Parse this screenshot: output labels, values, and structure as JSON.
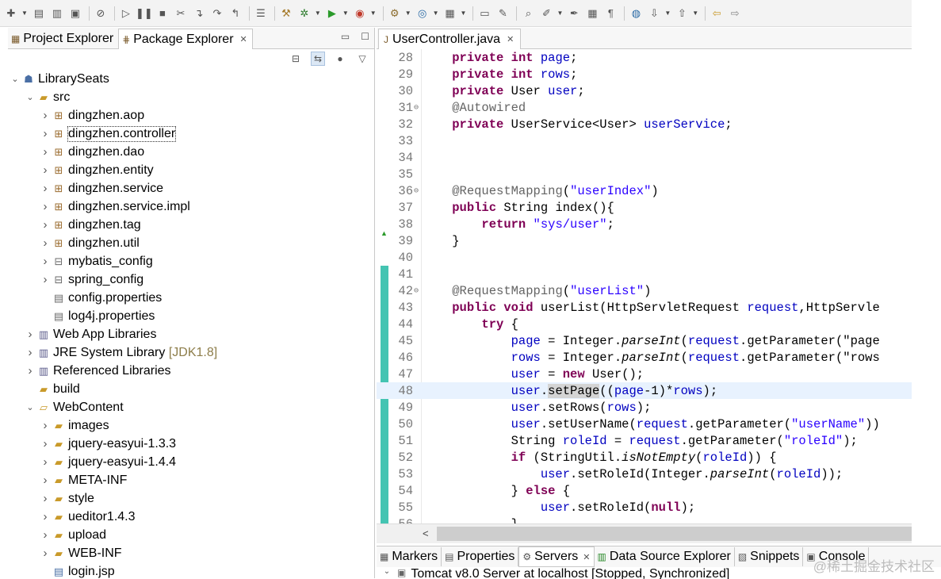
{
  "toolbar": {
    "icons": [
      "new-icon",
      "save-icon",
      "save-all-icon",
      "print-icon",
      "skip-breakpoints-icon",
      "resume-icon",
      "suspend-icon",
      "terminate-icon",
      "disconnect-icon",
      "step-into-icon",
      "step-over-icon",
      "step-return-icon",
      "open-task-icon",
      "build-icon",
      "debug-icon",
      "run-icon",
      "run-external-icon",
      "new-server-icon",
      "new-java-project-icon",
      "open-type-icon",
      "open-folder-icon",
      "open-resource-icon",
      "search-icon",
      "annotation-icon",
      "pen-icon",
      "block-icon",
      "paragraph-icon",
      "globe-icon",
      "next-annotation-icon",
      "previous-annotation-icon",
      "back-icon",
      "forward-icon"
    ]
  },
  "explorer": {
    "tabs": [
      {
        "label": "Project Explorer",
        "active": false
      },
      {
        "label": "Package Explorer",
        "active": true
      }
    ],
    "tree": [
      {
        "label": "LibrarySeats",
        "level": 0,
        "chevron": "open",
        "icon": "project-icon"
      },
      {
        "label": "src",
        "level": 1,
        "chevron": "open",
        "icon": "source-folder-icon"
      },
      {
        "label": "dingzhen.aop",
        "level": 2,
        "chevron": "closed",
        "icon": "package-icon"
      },
      {
        "label": "dingzhen.controller",
        "level": 2,
        "chevron": "closed",
        "icon": "package-icon",
        "selected": true
      },
      {
        "label": "dingzhen.dao",
        "level": 2,
        "chevron": "closed",
        "icon": "package-icon"
      },
      {
        "label": "dingzhen.entity",
        "level": 2,
        "chevron": "closed",
        "icon": "package-icon"
      },
      {
        "label": "dingzhen.service",
        "level": 2,
        "chevron": "closed",
        "icon": "package-icon"
      },
      {
        "label": "dingzhen.service.impl",
        "level": 2,
        "chevron": "closed",
        "icon": "package-icon"
      },
      {
        "label": "dingzhen.tag",
        "level": 2,
        "chevron": "closed",
        "icon": "package-icon"
      },
      {
        "label": "dingzhen.util",
        "level": 2,
        "chevron": "closed",
        "icon": "package-icon"
      },
      {
        "label": "mybatis_config",
        "level": 2,
        "chevron": "closed",
        "icon": "config-package-icon"
      },
      {
        "label": "spring_config",
        "level": 2,
        "chevron": "closed",
        "icon": "config-package-icon"
      },
      {
        "label": "config.properties",
        "level": 2,
        "chevron": "none",
        "icon": "file-icon"
      },
      {
        "label": "log4j.properties",
        "level": 2,
        "chevron": "none",
        "icon": "file-icon"
      },
      {
        "label": "Web App Libraries",
        "level": 1,
        "chevron": "closed",
        "icon": "library-icon"
      },
      {
        "label": "JRE System Library",
        "suffix": "[JDK1.8]",
        "level": 1,
        "chevron": "closed",
        "icon": "library-icon"
      },
      {
        "label": "Referenced Libraries",
        "level": 1,
        "chevron": "closed",
        "icon": "library-icon"
      },
      {
        "label": "build",
        "level": 1,
        "chevron": "none",
        "icon": "folder-icon"
      },
      {
        "label": "WebContent",
        "level": 1,
        "chevron": "open",
        "icon": "folder-open-icon"
      },
      {
        "label": "images",
        "level": 2,
        "chevron": "closed",
        "icon": "folder-icon"
      },
      {
        "label": "jquery-easyui-1.3.3",
        "level": 2,
        "chevron": "closed",
        "icon": "folder-icon"
      },
      {
        "label": "jquery-easyui-1.4.4",
        "level": 2,
        "chevron": "closed",
        "icon": "folder-icon"
      },
      {
        "label": "META-INF",
        "level": 2,
        "chevron": "closed",
        "icon": "folder-icon"
      },
      {
        "label": "style",
        "level": 2,
        "chevron": "closed",
        "icon": "folder-icon"
      },
      {
        "label": "ueditor1.4.3",
        "level": 2,
        "chevron": "closed",
        "icon": "folder-icon"
      },
      {
        "label": "upload",
        "level": 2,
        "chevron": "closed",
        "icon": "folder-icon"
      },
      {
        "label": "WEB-INF",
        "level": 2,
        "chevron": "closed",
        "icon": "folder-icon"
      },
      {
        "label": "login.jsp",
        "level": 2,
        "chevron": "none",
        "icon": "jsp-file-icon"
      }
    ]
  },
  "editor": {
    "tab_label": "UserController.java",
    "current_line": 48,
    "lines": [
      {
        "n": "28",
        "tokens": [
          [
            "    ",
            ""
          ],
          [
            "private",
            "kw"
          ],
          [
            " ",
            ""
          ],
          [
            "int",
            "kw"
          ],
          [
            " ",
            ""
          ],
          [
            "page",
            "fld"
          ],
          [
            ";",
            ""
          ]
        ]
      },
      {
        "n": "29",
        "tokens": [
          [
            "    ",
            ""
          ],
          [
            "private",
            "kw"
          ],
          [
            " ",
            ""
          ],
          [
            "int",
            "kw"
          ],
          [
            " ",
            ""
          ],
          [
            "rows",
            "fld"
          ],
          [
            ";",
            ""
          ]
        ]
      },
      {
        "n": "30",
        "tokens": [
          [
            "    ",
            ""
          ],
          [
            "private",
            "kw"
          ],
          [
            " User ",
            ""
          ],
          [
            "user",
            "fld"
          ],
          [
            ";",
            ""
          ]
        ]
      },
      {
        "n": "31",
        "fold": true,
        "tokens": [
          [
            "    ",
            ""
          ],
          [
            "@Autowired",
            "ann"
          ]
        ]
      },
      {
        "n": "32",
        "tokens": [
          [
            "    ",
            ""
          ],
          [
            "private",
            "kw"
          ],
          [
            " UserService<User> ",
            ""
          ],
          [
            "userService",
            "fld"
          ],
          [
            ";",
            ""
          ]
        ]
      },
      {
        "n": "33",
        "tokens": []
      },
      {
        "n": "34",
        "tokens": []
      },
      {
        "n": "35",
        "tokens": []
      },
      {
        "n": "36",
        "fold": true,
        "tokens": [
          [
            "    ",
            ""
          ],
          [
            "@RequestMapping",
            "ann"
          ],
          [
            "(",
            ""
          ],
          [
            "\"userIndex\"",
            "str"
          ],
          [
            ")",
            ""
          ]
        ]
      },
      {
        "n": "37",
        "tokens": [
          [
            "    ",
            ""
          ],
          [
            "public",
            "kw"
          ],
          [
            " String index(){",
            ""
          ]
        ]
      },
      {
        "n": "38",
        "tokens": [
          [
            "        ",
            ""
          ],
          [
            "return",
            "kw"
          ],
          [
            " ",
            ""
          ],
          [
            "\"sys/user\"",
            "str"
          ],
          [
            ";",
            ""
          ]
        ]
      },
      {
        "n": "39",
        "tokens": [
          [
            "    }",
            ""
          ]
        ]
      },
      {
        "n": "40",
        "tokens": []
      },
      {
        "n": "41",
        "tokens": []
      },
      {
        "n": "42",
        "fold": true,
        "tokens": [
          [
            "    ",
            ""
          ],
          [
            "@RequestMapping",
            "ann"
          ],
          [
            "(",
            ""
          ],
          [
            "\"userList\"",
            "str"
          ],
          [
            ")",
            ""
          ]
        ]
      },
      {
        "n": "43",
        "tokens": [
          [
            "    ",
            ""
          ],
          [
            "public",
            "kw"
          ],
          [
            " ",
            ""
          ],
          [
            "void",
            "kw"
          ],
          [
            " userList(HttpServletRequest ",
            ""
          ],
          [
            "request",
            "fld"
          ],
          [
            ",HttpServle",
            ""
          ]
        ]
      },
      {
        "n": "44",
        "tokens": [
          [
            "        ",
            ""
          ],
          [
            "try",
            "kw"
          ],
          [
            " {",
            ""
          ]
        ]
      },
      {
        "n": "45",
        "tokens": [
          [
            "            ",
            ""
          ],
          [
            "page",
            "fld"
          ],
          [
            " = Integer.",
            ""
          ],
          [
            "parseInt",
            "it"
          ],
          [
            "(",
            ""
          ],
          [
            "request",
            "fld"
          ],
          [
            ".getParameter(",
            ""
          ],
          [
            "\"page",
            ""
          ]
        ]
      },
      {
        "n": "46",
        "tokens": [
          [
            "            ",
            ""
          ],
          [
            "rows",
            "fld"
          ],
          [
            " = Integer.",
            ""
          ],
          [
            "parseInt",
            "it"
          ],
          [
            "(",
            ""
          ],
          [
            "request",
            "fld"
          ],
          [
            ".getParameter(",
            ""
          ],
          [
            "\"rows",
            ""
          ]
        ]
      },
      {
        "n": "47",
        "tokens": [
          [
            "            ",
            ""
          ],
          [
            "user",
            "fld"
          ],
          [
            " = ",
            ""
          ],
          [
            "new",
            "kw"
          ],
          [
            " User();",
            ""
          ]
        ]
      },
      {
        "n": "48",
        "tokens": [
          [
            "            ",
            ""
          ],
          [
            "user",
            "fld"
          ],
          [
            ".",
            ""
          ],
          [
            "setPage",
            "hl"
          ],
          [
            "((",
            ""
          ],
          [
            "page",
            "fld"
          ],
          [
            "-1)*",
            ""
          ],
          [
            "rows",
            "fld"
          ],
          [
            ");",
            ""
          ]
        ]
      },
      {
        "n": "49",
        "tokens": [
          [
            "            ",
            ""
          ],
          [
            "user",
            "fld"
          ],
          [
            ".setRows(",
            ""
          ],
          [
            "rows",
            "fld"
          ],
          [
            ");",
            ""
          ]
        ]
      },
      {
        "n": "50",
        "tokens": [
          [
            "            ",
            ""
          ],
          [
            "user",
            "fld"
          ],
          [
            ".setUserName(",
            ""
          ],
          [
            "request",
            "fld"
          ],
          [
            ".getParameter(",
            ""
          ],
          [
            "\"userName\"",
            "str"
          ],
          [
            "))",
            ""
          ]
        ]
      },
      {
        "n": "51",
        "tokens": [
          [
            "            String ",
            ""
          ],
          [
            "roleId",
            "fld"
          ],
          [
            " = ",
            ""
          ],
          [
            "request",
            "fld"
          ],
          [
            ".getParameter(",
            ""
          ],
          [
            "\"roleId\"",
            "str"
          ],
          [
            ");",
            ""
          ]
        ]
      },
      {
        "n": "52",
        "tokens": [
          [
            "            ",
            ""
          ],
          [
            "if",
            "kw"
          ],
          [
            " (StringUtil.",
            ""
          ],
          [
            "isNotEmpty",
            "it"
          ],
          [
            "(",
            ""
          ],
          [
            "roleId",
            "fld"
          ],
          [
            ")) {",
            ""
          ]
        ]
      },
      {
        "n": "53",
        "tokens": [
          [
            "                ",
            ""
          ],
          [
            "user",
            "fld"
          ],
          [
            ".setRoleId(Integer.",
            ""
          ],
          [
            "parseInt",
            "it"
          ],
          [
            "(",
            ""
          ],
          [
            "roleId",
            "fld"
          ],
          [
            "));",
            ""
          ]
        ]
      },
      {
        "n": "54",
        "tokens": [
          [
            "            } ",
            ""
          ],
          [
            "else",
            "kw"
          ],
          [
            " {",
            ""
          ]
        ]
      },
      {
        "n": "55",
        "tokens": [
          [
            "                ",
            ""
          ],
          [
            "user",
            "fld"
          ],
          [
            ".setRoleId(",
            ""
          ],
          [
            "null",
            "kw"
          ],
          [
            ");",
            ""
          ]
        ]
      },
      {
        "n": "56",
        "tokens": [
          [
            "            }",
            ""
          ]
        ]
      }
    ]
  },
  "bottom": {
    "tabs": [
      {
        "label": "Markers",
        "icon": "markers-icon"
      },
      {
        "label": "Properties",
        "icon": "properties-icon"
      },
      {
        "label": "Servers",
        "icon": "servers-icon",
        "active": true
      },
      {
        "label": "Data Source Explorer",
        "icon": "data-source-icon"
      },
      {
        "label": "Snippets",
        "icon": "snippets-icon"
      },
      {
        "label": "Console",
        "icon": "console-icon"
      }
    ],
    "server_entry": "Tomcat v8.0 Server at localhost  [Stopped, Synchronized]",
    "watermark": "@稀土掘金技术社区"
  }
}
